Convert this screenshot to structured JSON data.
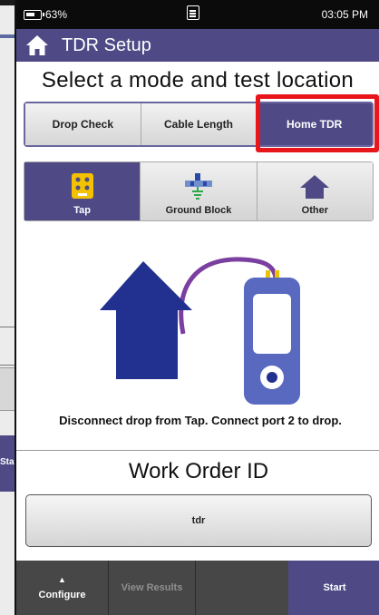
{
  "status": {
    "battery": "63%",
    "time": "03:05 PM"
  },
  "header": {
    "title": "TDR Setup"
  },
  "heading": "Select a mode and test location",
  "modes": [
    {
      "label": "Drop Check",
      "active": false
    },
    {
      "label": "Cable Length",
      "active": false
    },
    {
      "label": "Home TDR",
      "active": true
    }
  ],
  "locations": [
    {
      "label": "Tap",
      "icon": "tap-icon",
      "active": true
    },
    {
      "label": "Ground Block",
      "icon": "ground-block-icon",
      "active": false
    },
    {
      "label": "Other",
      "icon": "house-icon",
      "active": false
    }
  ],
  "instruction": "Disconnect drop from Tap. Connect port 2 to drop.",
  "work_order": {
    "label": "Work Order ID",
    "value": "tdr"
  },
  "bottom": {
    "configure": "Configure",
    "view_results": "View Results",
    "start": "Start"
  },
  "background_window": {
    "start": "Start"
  },
  "colors": {
    "accent": "#4f4a86",
    "highlight": "#e8151b",
    "house": "#22318f",
    "cable": "#7b3fa0"
  }
}
